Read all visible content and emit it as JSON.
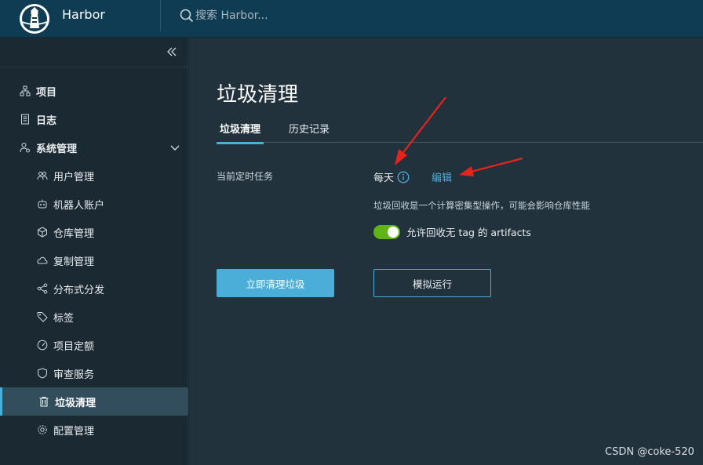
{
  "header": {
    "brand": "Harbor",
    "search_placeholder": "搜索 Harbor..."
  },
  "sidebar": {
    "items": [
      {
        "label": "项目",
        "icon": "sitemap-icon",
        "level": 1
      },
      {
        "label": "日志",
        "icon": "log-icon",
        "level": 1
      },
      {
        "label": "系统管理",
        "icon": "user-gear-icon",
        "level": 1,
        "expanded": true
      },
      {
        "label": "用户管理",
        "icon": "users-icon",
        "level": 2
      },
      {
        "label": "机器人账户",
        "icon": "robot-icon",
        "level": 2
      },
      {
        "label": "仓库管理",
        "icon": "cube-icon",
        "level": 2
      },
      {
        "label": "复制管理",
        "icon": "cloud-sync-icon",
        "level": 2
      },
      {
        "label": "分布式分发",
        "icon": "share-icon",
        "level": 2
      },
      {
        "label": "标签",
        "icon": "tag-icon",
        "level": 2
      },
      {
        "label": "项目定额",
        "icon": "gauge-icon",
        "level": 2
      },
      {
        "label": "审查服务",
        "icon": "shield-icon",
        "level": 2
      },
      {
        "label": "垃圾清理",
        "icon": "trash-icon",
        "level": 2,
        "active": true
      },
      {
        "label": "配置管理",
        "icon": "gear-icon",
        "level": 2
      }
    ]
  },
  "main": {
    "title": "垃圾清理",
    "tabs": [
      {
        "label": "垃圾清理",
        "active": true
      },
      {
        "label": "历史记录",
        "active": false
      }
    ],
    "schedule_label": "当前定时任务",
    "schedule_value": "每天",
    "edit_label": "编辑",
    "description": "垃圾回收是一个计算密集型操作，可能会影响仓库性能",
    "toggle_label": "允许回收无 tag 的 artifacts",
    "toggle_on": true,
    "run_button": "立即清理垃圾",
    "dry_run_button": "模拟运行"
  },
  "watermark": "CSDN @coke-520",
  "colors": {
    "header_bg": "#0f3b53",
    "sidebar_bg": "#1b2a32",
    "main_bg": "#21323c",
    "accent": "#4aaed9",
    "toggle_on": "#60b515",
    "annotation_arrow": "#e8231b"
  }
}
